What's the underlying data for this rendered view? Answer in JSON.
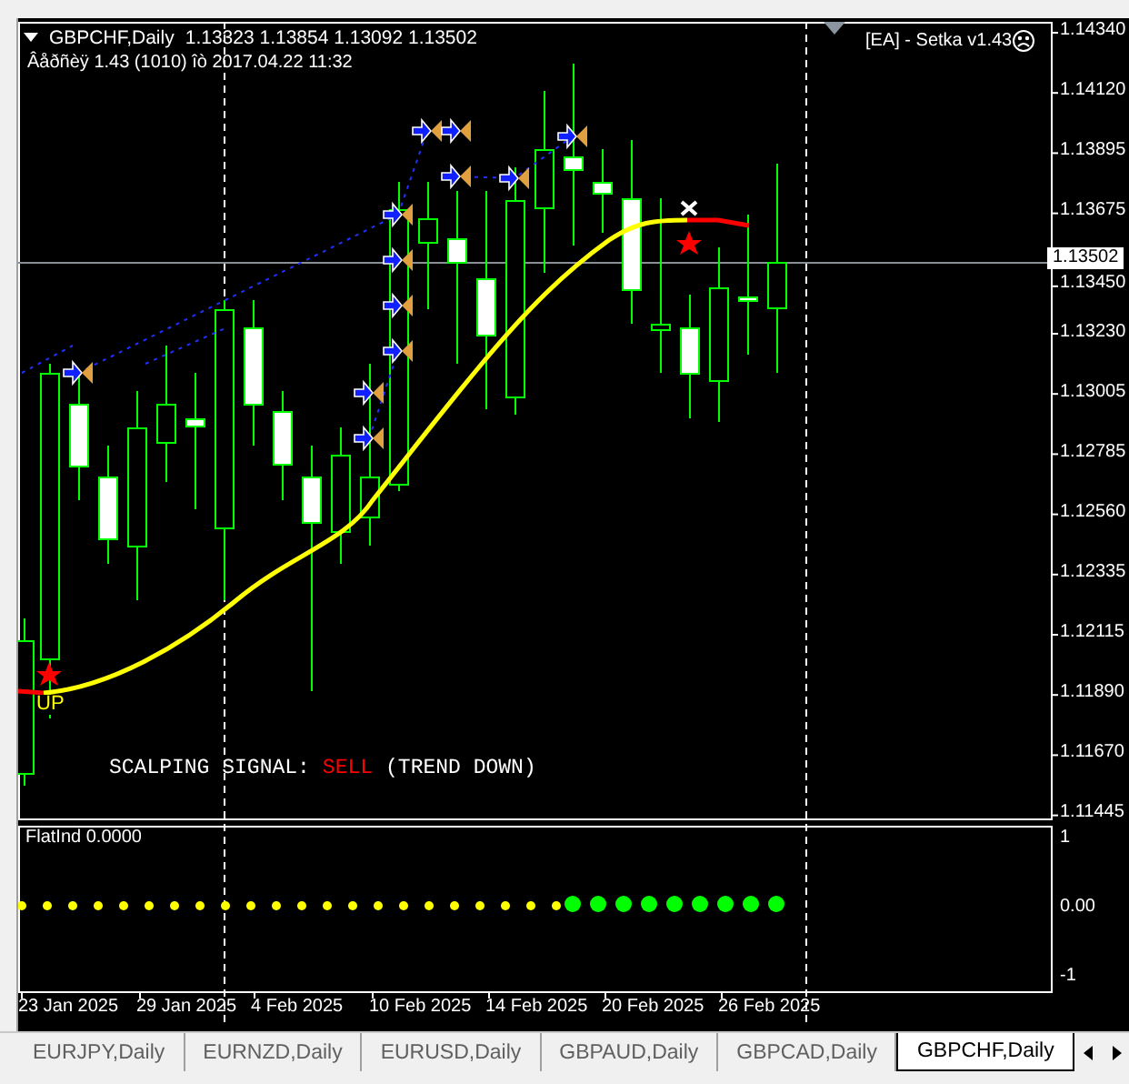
{
  "chart": {
    "header": {
      "title": "GBPCHF,Daily",
      "ohlc": "1.13323 1.13854 1.13092 1.13502"
    },
    "version_line": "Âåðñèÿ 1.43 (1010) îò 2017.04.22 11:32",
    "ea_label": "[EA] - Setka v1.43",
    "marker": "UP",
    "signal": {
      "label": "SCALPING SIGNAL:",
      "value": "SELL",
      "trend": "(TREND DOWN)"
    },
    "price_axis": [
      "1.14340",
      "1.14120",
      "1.13895",
      "1.13675",
      "1.13450",
      "1.13230",
      "1.13005",
      "1.12785",
      "1.12560",
      "1.12335",
      "1.12115",
      "1.11890",
      "1.11670",
      "1.11445"
    ],
    "current_price": "1.13502",
    "indicator": {
      "name": "FlatInd 0.0000",
      "axis": [
        "1",
        "0.00",
        "-1"
      ]
    },
    "date_axis": [
      "23 Jan 2025",
      "29 Jan 2025",
      "4 Feb 2025",
      "10 Feb 2025",
      "14 Feb 2025",
      "20 Feb 2025",
      "26 Feb 2025"
    ]
  },
  "tabs": [
    {
      "label": "EURJPY,Daily",
      "selected": false
    },
    {
      "label": "EURNZD,Daily",
      "selected": false
    },
    {
      "label": "EURUSD,Daily",
      "selected": false
    },
    {
      "label": "GBPAUD,Daily",
      "selected": false
    },
    {
      "label": "GBPCAD,Daily",
      "selected": false
    },
    {
      "label": "GBPCHF,Daily",
      "selected": true
    }
  ]
}
